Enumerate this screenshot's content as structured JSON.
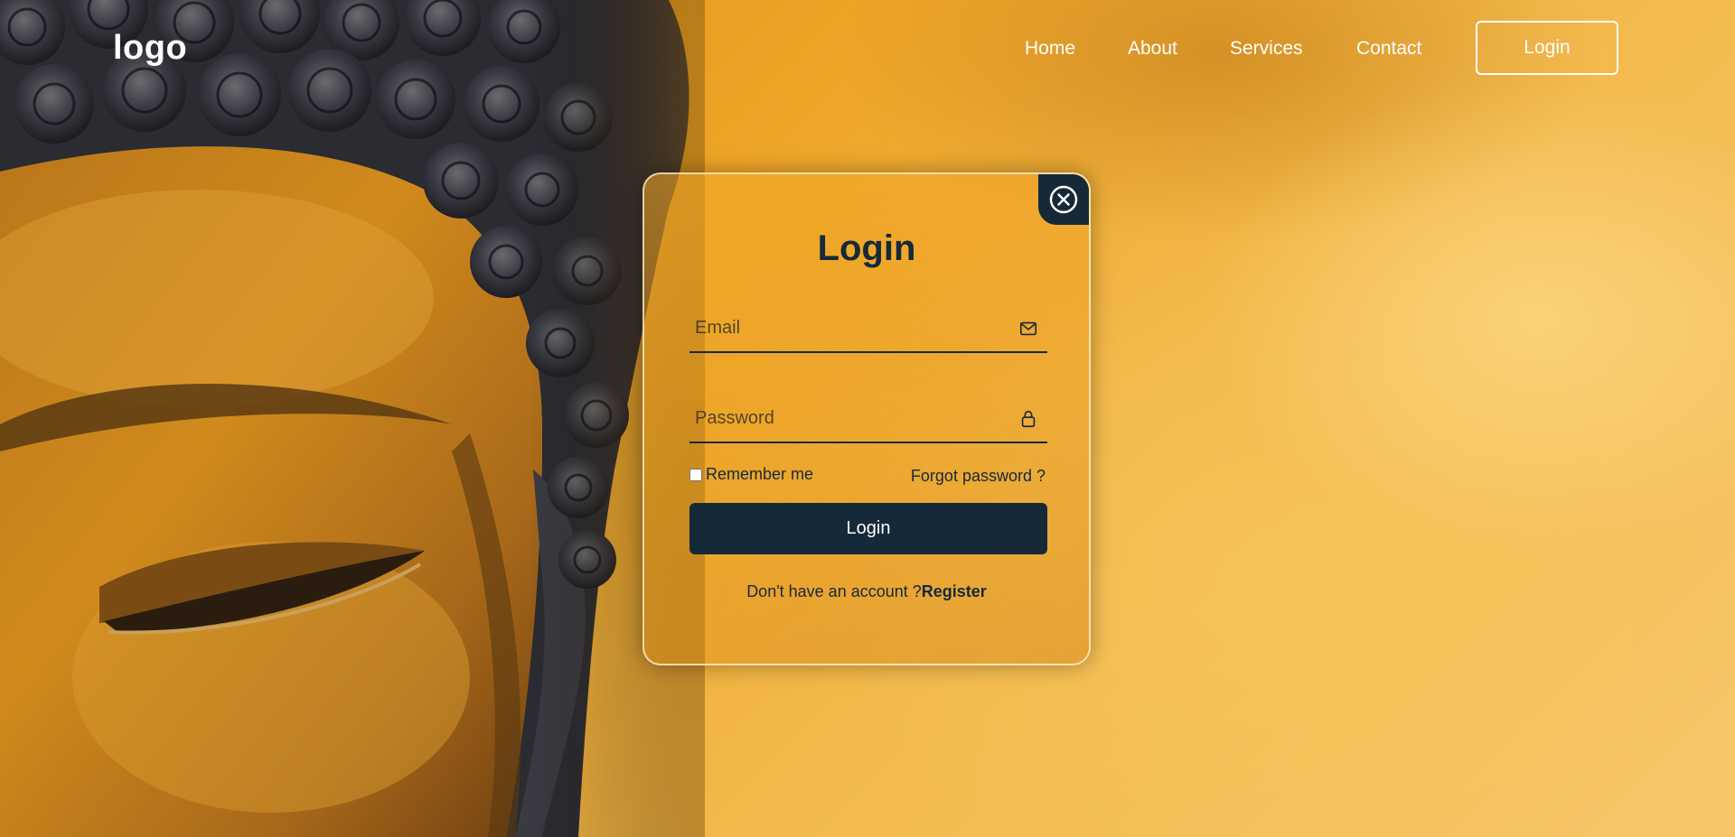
{
  "header": {
    "logo_text": "logo",
    "nav": {
      "home": "Home",
      "about": "About",
      "services": "Services",
      "contact": "Contact",
      "login_button": "Login"
    }
  },
  "login_card": {
    "title": "Login",
    "email": {
      "placeholder": "Email",
      "value": "",
      "icon": "mail-icon"
    },
    "password": {
      "placeholder": "Password",
      "value": "",
      "icon": "lock-icon"
    },
    "remember_label": "Remember me",
    "remember_checked": false,
    "forgot_label": "Forgot password ?",
    "submit_label": "Login",
    "register_prompt": "Don't have an account ?",
    "register_link": "Register",
    "close_icon": "close-icon"
  },
  "colors": {
    "accent": "#162938",
    "text_light": "#ffffff",
    "background_warm": "#eda526"
  }
}
